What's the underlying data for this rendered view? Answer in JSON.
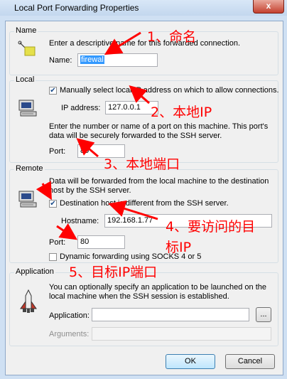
{
  "window": {
    "title": "Local Port Forwarding Properties",
    "close_label": "x"
  },
  "name_group": {
    "label": "Name",
    "description": "Enter a descriptive name for this forwarded connection.",
    "name_label": "Name:",
    "name_value": "firewal"
  },
  "local_group": {
    "label": "Local",
    "manual_checkbox_label": "Manually select local IP address on which to allow connections.",
    "manual_checked": true,
    "ip_label": "IP address:",
    "ip_value": "127.0.0.1",
    "port_description_line1": "Enter the number or name of a port on this machine.  This port's",
    "port_description_line2": "data will be securely forwarded to the SSH server.",
    "port_label": "Port:",
    "port_value": "80"
  },
  "remote_group": {
    "label": "Remote",
    "description_line1": "Data will be forwarded from the local machine to the destination",
    "description_line2": "host by the SSH server.",
    "dest_checkbox_label": "Destination host is different from the SSH server.",
    "dest_checked": true,
    "hostname_label": "Hostname:",
    "hostname_value": "192.168.1.77",
    "port_label": "Port:",
    "port_value": "80",
    "dynamic_checkbox_label": "Dynamic forwarding using SOCKS 4 or 5",
    "dynamic_checked": false
  },
  "application_group": {
    "label": "Application",
    "description_line1": "You can optionally specify an application to be launched on the",
    "description_line2": "local machine when the SSH session is established.",
    "application_label": "Application:",
    "application_value": "",
    "browse_label": "...",
    "arguments_label": "Arguments:",
    "arguments_value": ""
  },
  "buttons": {
    "ok": "OK",
    "cancel": "Cancel"
  },
  "annotations": {
    "a1": "1、命名",
    "a2": "2、本地IP",
    "a3": "3、本地端口",
    "a4_line1": "4、要访问的目",
    "a4_line2": "标IP",
    "a5": "5、目标IP端口"
  },
  "colors": {
    "annotation": "#ff0000",
    "selection": "#3399ff"
  },
  "icons": {
    "name": "tag-icon",
    "local": "computer-icon",
    "remote": "computer-icon",
    "application": "rocket-icon"
  }
}
